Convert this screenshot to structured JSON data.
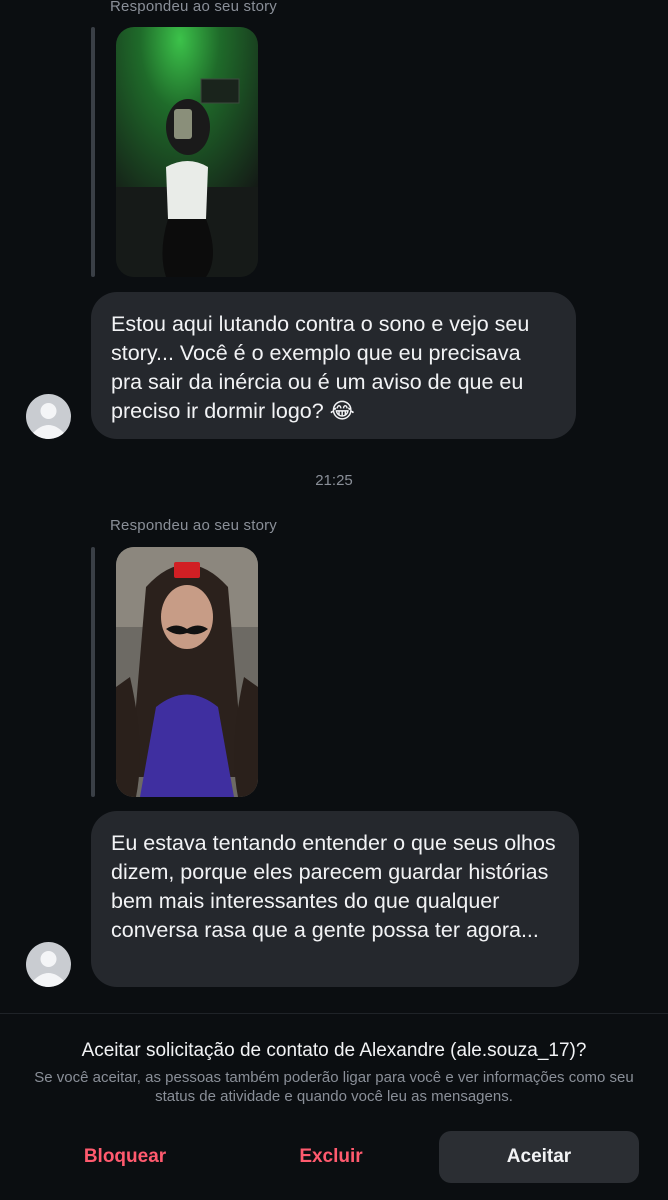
{
  "conversation": {
    "messages": [
      {
        "story_label": "Respondeu ao seu story",
        "text": "Estou aqui lutando contra o sono e vejo seu story... Você é o exemplo que eu precisava pra sair da inércia ou é um aviso de que eu preciso ir dormir logo? 😂"
      },
      {
        "timestamp": "21:25",
        "story_label": "Respondeu ao seu story",
        "text": "Eu estava tentando entender o que seus olhos dizem, porque eles parecem guardar histórias bem mais interessantes do que qualquer conversa rasa que a gente possa ter agora..."
      }
    ]
  },
  "request": {
    "title": "Aceitar solicitação de contato de Alexandre (ale.souza_17)?",
    "description": "Se você aceitar, as pessoas também poderão ligar para você e ver informações como seu status de atividade e quando você leu as mensagens.",
    "actions": {
      "block": "Bloquear",
      "delete": "Excluir",
      "accept": "Aceitar"
    },
    "colors": {
      "danger": "#ff5a6e",
      "accept_bg": "#2b2e33"
    }
  },
  "icons": {
    "avatar": "default-avatar-icon"
  }
}
